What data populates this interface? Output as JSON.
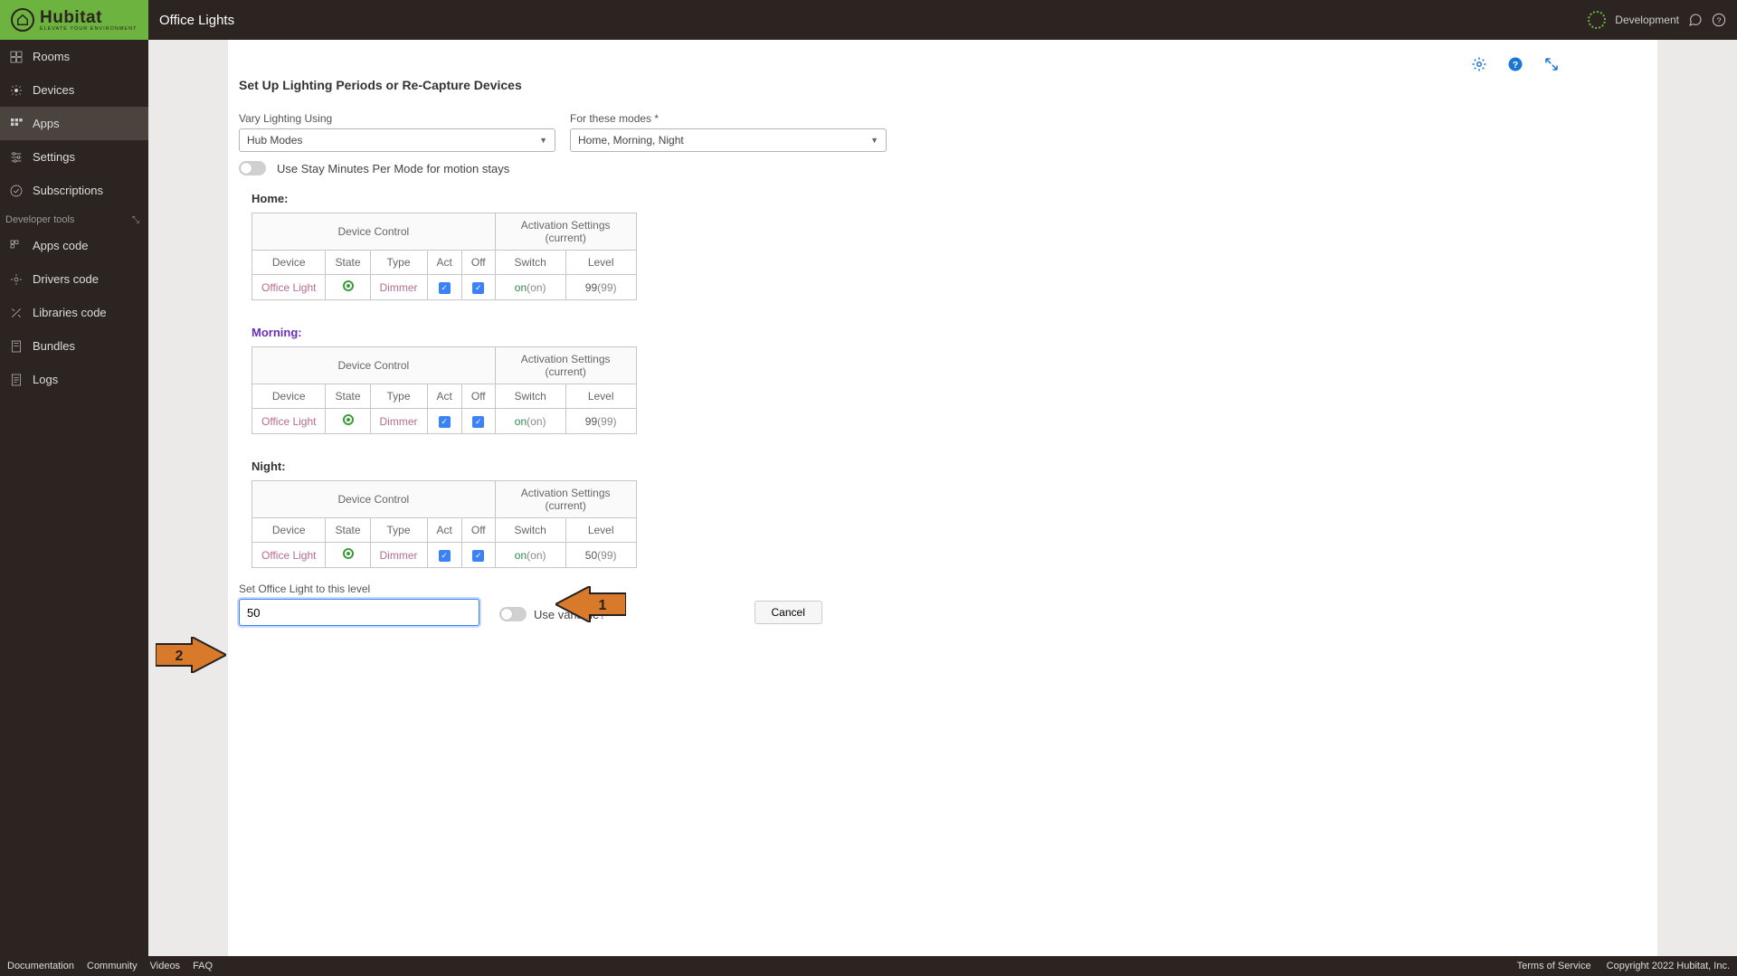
{
  "header": {
    "title": "Office Lights",
    "environment": "Development"
  },
  "sidebar": {
    "items": [
      {
        "label": "Rooms"
      },
      {
        "label": "Devices"
      },
      {
        "label": "Apps"
      },
      {
        "label": "Settings"
      },
      {
        "label": "Subscriptions"
      }
    ],
    "devSection": "Developer tools",
    "devItems": [
      {
        "label": "Apps code"
      },
      {
        "label": "Drivers code"
      },
      {
        "label": "Libraries code"
      },
      {
        "label": "Bundles"
      },
      {
        "label": "Logs"
      }
    ]
  },
  "page": {
    "sectionTitle": "Set Up Lighting Periods or Re-Capture Devices",
    "varyLabel": "Vary Lighting Using",
    "varyValue": "Hub Modes",
    "modesLabel": "For these modes *",
    "modesValue": "Home, Morning, Night",
    "stayMinutesLabel": "Use Stay Minutes Per Mode for motion stays"
  },
  "tableHeaders": {
    "deviceControl": "Device Control",
    "activationSettings": "Activation Settings (current)",
    "device": "Device",
    "state": "State",
    "type": "Type",
    "act": "Act",
    "off": "Off",
    "switch": "Switch",
    "level": "Level"
  },
  "modes": {
    "home": {
      "title": "Home:",
      "device": "Office Light",
      "type": "Dimmer",
      "switchOn": "on",
      "switchCur": "(on)",
      "levelVal": "99",
      "levelCur": "(99)"
    },
    "morning": {
      "title": "Morning:",
      "device": "Office Light",
      "type": "Dimmer",
      "switchOn": "on",
      "switchCur": "(on)",
      "levelVal": "99",
      "levelCur": "(99)"
    },
    "night": {
      "title": "Night:",
      "device": "Office Light",
      "type": "Dimmer",
      "switchOn": "on",
      "switchCur": "(on)",
      "levelVal": "50",
      "levelCur": "(99)"
    }
  },
  "levelInput": {
    "label": "Set Office Light to this level",
    "value": "50",
    "useVariable": "Use variable?",
    "cancel": "Cancel"
  },
  "arrows": {
    "one": "1",
    "two": "2"
  },
  "footer": {
    "documentation": "Documentation",
    "community": "Community",
    "videos": "Videos",
    "faq": "FAQ",
    "terms": "Terms of Service",
    "copyright": "Copyright 2022 Hubitat, Inc."
  },
  "brand": {
    "name": "Hubitat",
    "tagline": "ELEVATE YOUR ENVIRONMENT"
  }
}
